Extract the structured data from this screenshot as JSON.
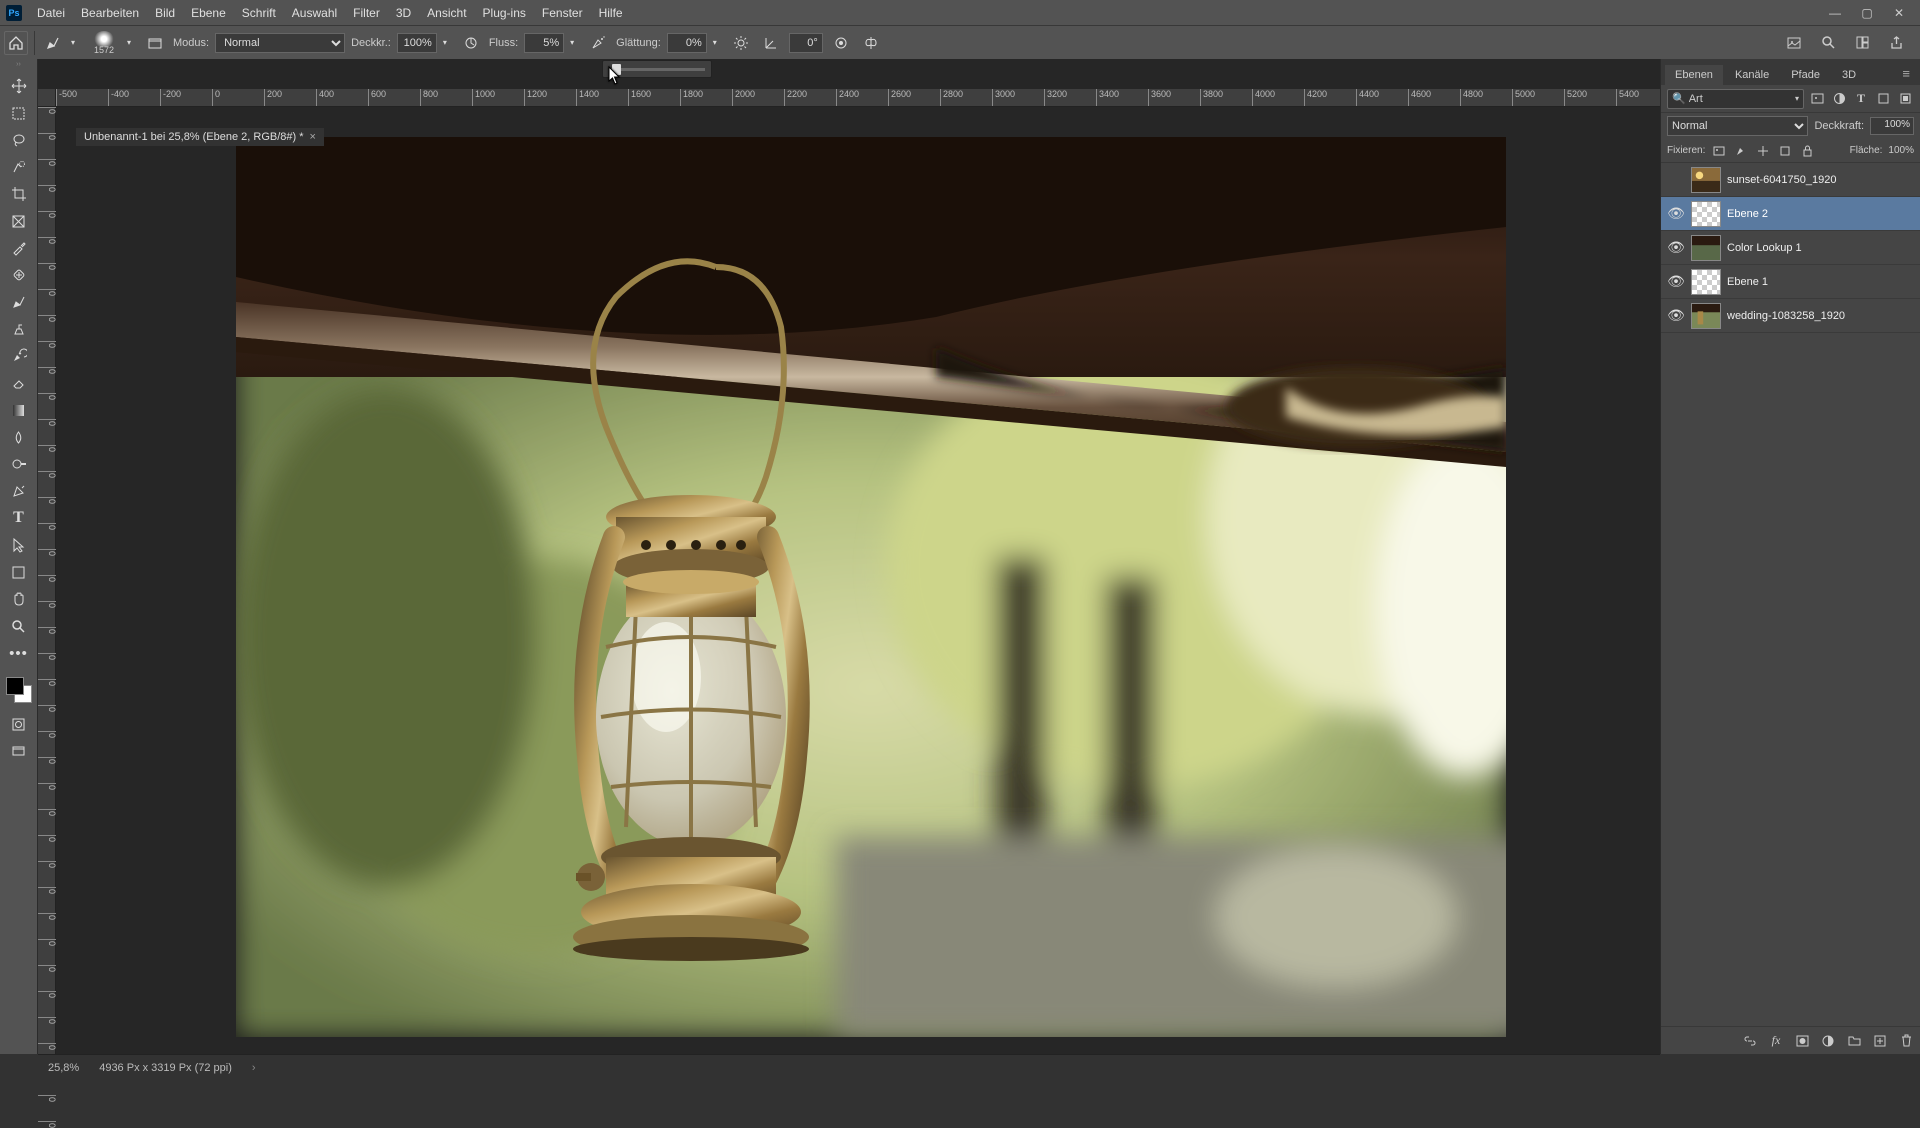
{
  "menu": {
    "items": [
      "Datei",
      "Bearbeiten",
      "Bild",
      "Ebene",
      "Schrift",
      "Auswahl",
      "Filter",
      "3D",
      "Ansicht",
      "Plug-ins",
      "Fenster",
      "Hilfe"
    ]
  },
  "options": {
    "brush_size": "1572",
    "mode_label": "Modus:",
    "mode_value": "Normal",
    "opacity_label": "Deckkr.:",
    "opacity_value": "100%",
    "flow_label": "Fluss:",
    "flow_value": "5%",
    "smoothing_label": "Glättung:",
    "smoothing_value": "0%",
    "angle_value": "0°"
  },
  "tab": {
    "title": "Unbenannt-1 bei 25,8% (Ebene 2, RGB/8#) *"
  },
  "ruler_h": [
    "-500",
    "-400",
    "-200",
    "0",
    "200",
    "400",
    "600",
    "800",
    "1000",
    "1200",
    "1400",
    "1600",
    "1800",
    "2000",
    "2200",
    "2400",
    "2600",
    "2800",
    "3000",
    "3200",
    "3400",
    "3600",
    "3800",
    "4000",
    "4200",
    "4400",
    "4600",
    "4800",
    "5000",
    "5200",
    "5400"
  ],
  "panels": {
    "tabs": [
      "Ebenen",
      "Kanäle",
      "Pfade",
      "3D"
    ],
    "search_value": "Art",
    "blend_mode": "Normal",
    "opacity_label": "Deckkraft:",
    "opacity_value": "100%",
    "lock_label": "Fixieren:",
    "fill_label": "Fläche:",
    "fill_value": "100%"
  },
  "layers": [
    {
      "visible": false,
      "thumb": "photo",
      "name": "sunset-6041750_1920"
    },
    {
      "visible": true,
      "thumb": "checker",
      "name": "Ebene 2",
      "selected": true
    },
    {
      "visible": true,
      "thumb": "adj",
      "name": "Color Lookup 1"
    },
    {
      "visible": true,
      "thumb": "checker",
      "name": "Ebene 1"
    },
    {
      "visible": true,
      "thumb": "photo",
      "name": "wedding-1083258_1920"
    }
  ],
  "status": {
    "zoom": "25,8%",
    "info": "4936 Px x 3319 Px (72 ppi)"
  }
}
